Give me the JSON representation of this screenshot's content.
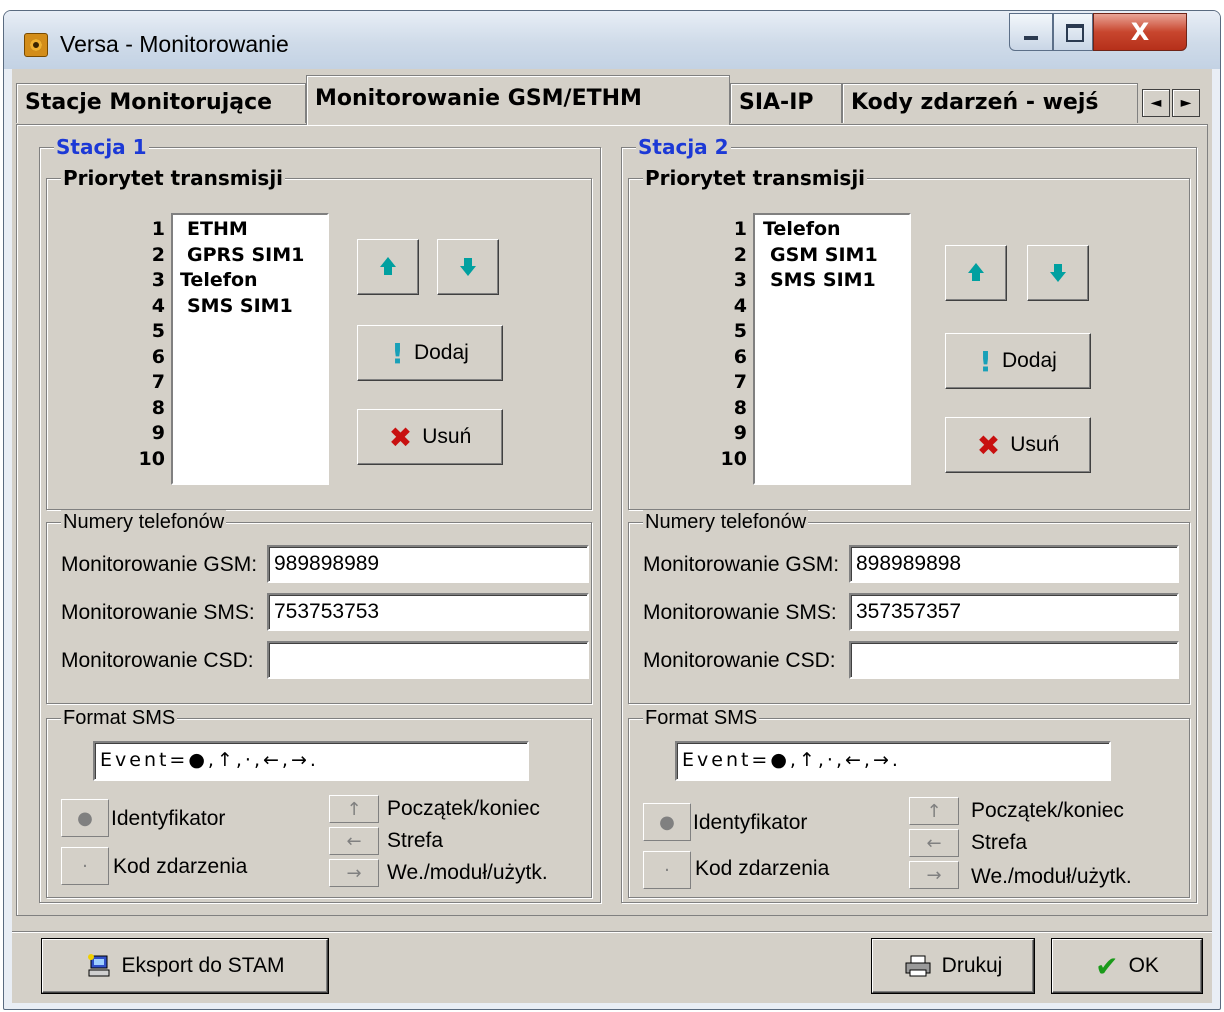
{
  "window": {
    "title": "Versa - Monitorowanie",
    "close_label": "X"
  },
  "tabs": [
    {
      "label": "Stacje Monitorujące"
    },
    {
      "label": "Monitorowanie GSM/ETHM"
    },
    {
      "label": "SIA-IP"
    },
    {
      "label": "Kody zdarzeń - wejś"
    }
  ],
  "tab_scroll": {
    "left": "◄",
    "right": "►"
  },
  "stations": [
    {
      "title": "Stacja 1",
      "priority_label": "Priorytet transmisji",
      "priority_numbers": [
        "1",
        "2",
        "3",
        "4",
        "5",
        "6",
        "7",
        "8",
        "9",
        "10"
      ],
      "priority_items": [
        "ETHM",
        "GPRS SIM1",
        "Telefon",
        "SMS SIM1"
      ],
      "add_label": "Dodaj",
      "remove_label": "Usuń",
      "phones_label": "Numery telefonów",
      "gsm_label": "Monitorowanie GSM:",
      "gsm_value": "989898989",
      "sms_label": "Monitorowanie SMS:",
      "sms_value": "753753753",
      "csd_label": "Monitorowanie CSD:",
      "csd_value": "",
      "format_label": "Format SMS",
      "format_value": "Event=●,↑,·,←,→.",
      "identifier_label": "Identyfikator",
      "event_code_label": "Kod zdarzenia",
      "start_end_label": "Początek/koniec",
      "zone_label": "Strefa",
      "module_label": "We./moduł/użytk."
    },
    {
      "title": "Stacja 2",
      "priority_label": "Priorytet transmisji",
      "priority_numbers": [
        "1",
        "2",
        "3",
        "4",
        "5",
        "6",
        "7",
        "8",
        "9",
        "10"
      ],
      "priority_items": [
        "Telefon",
        "GSM SIM1",
        "SMS SIM1"
      ],
      "add_label": "Dodaj",
      "remove_label": "Usuń",
      "phones_label": "Numery telefonów",
      "gsm_label": "Monitorowanie GSM:",
      "gsm_value": "898989898",
      "sms_label": "Monitorowanie SMS:",
      "sms_value": "357357357",
      "csd_label": "Monitorowanie CSD:",
      "csd_value": "",
      "format_label": "Format SMS",
      "format_value": "Event=●,↑,·,←,→.",
      "identifier_label": "Identyfikator",
      "event_code_label": "Kod zdarzenia",
      "start_end_label": "Początek/koniec",
      "zone_label": "Strefa",
      "module_label": "We./moduł/użytk."
    }
  ],
  "footer": {
    "export_label": "Eksport do STAM",
    "print_label": "Drukuj",
    "ok_label": "OK"
  },
  "colors": {
    "station_title": "#1c39d6",
    "remove_icon": "#c81010",
    "ok_check": "#1a9a1a",
    "arrow_icon": "#00a0a0"
  }
}
